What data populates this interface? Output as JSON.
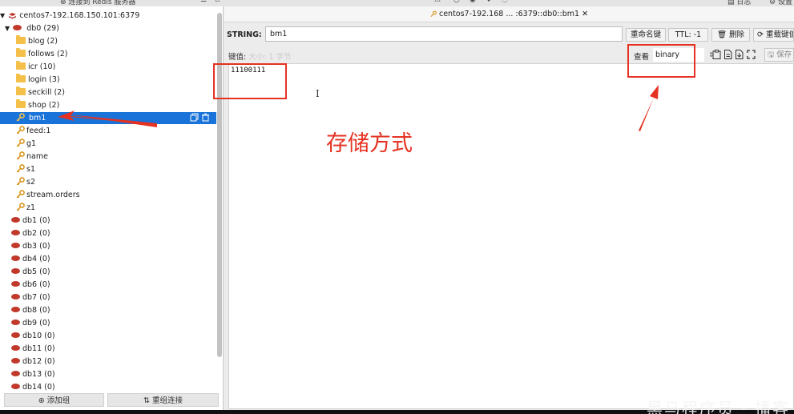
{
  "topbar": {
    "connect_label": "连接到 Redis 服务器",
    "log_label": "日志",
    "settings_label": "设置"
  },
  "tree": {
    "connection": "centos7-192.168.150.101:6379",
    "db0": {
      "name": "db0",
      "count": "(29)"
    },
    "folders": [
      {
        "label": "blog (2)"
      },
      {
        "label": "follows (2)"
      },
      {
        "label": "icr (10)"
      },
      {
        "label": "login (3)"
      },
      {
        "label": "seckill (2)"
      },
      {
        "label": "shop (2)"
      }
    ],
    "keys": [
      {
        "label": "bm1"
      },
      {
        "label": "feed:1"
      },
      {
        "label": "g1"
      },
      {
        "label": "name"
      },
      {
        "label": "s1"
      },
      {
        "label": "s2"
      },
      {
        "label": "stream.orders"
      },
      {
        "label": "z1"
      }
    ],
    "dbs": [
      {
        "label": "db1  (0)"
      },
      {
        "label": "db2  (0)"
      },
      {
        "label": "db3  (0)"
      },
      {
        "label": "db4  (0)"
      },
      {
        "label": "db5  (0)"
      },
      {
        "label": "db6  (0)"
      },
      {
        "label": "db7  (0)"
      },
      {
        "label": "db8  (0)"
      },
      {
        "label": "db9  (0)"
      },
      {
        "label": "db10  (0)"
      },
      {
        "label": "db11  (0)"
      },
      {
        "label": "db12  (0)"
      },
      {
        "label": "db13  (0)"
      },
      {
        "label": "db14  (0)"
      }
    ],
    "selected_key": "bm1"
  },
  "left_footer": {
    "add_group": "添加组",
    "reconnect": "重组连接"
  },
  "tab": {
    "title": "centos7-192.168 ... :6379::db0::bm1",
    "close": "✕"
  },
  "key_editor": {
    "type_label": "STRING:",
    "key_name": "bm1",
    "rename_label": "重命名键",
    "ttl_label": "TTL: -1",
    "delete_label": "删除",
    "reload_label": "重载键值",
    "value_label": "键值:",
    "value_size": "大小: 1 字节",
    "view_label": "查看",
    "view_mode": "binary",
    "save_label": "保存",
    "value": "11100111"
  },
  "annotation": {
    "text": "存储方式"
  },
  "watermark": {
    "text": "黑马程序员 · 播客"
  },
  "colors": {
    "selection": "#1a73d9",
    "annotation": "#e53222",
    "folder": "#f4c04a",
    "key_icon": "#d8961c",
    "db_icon": "#c0392b"
  }
}
